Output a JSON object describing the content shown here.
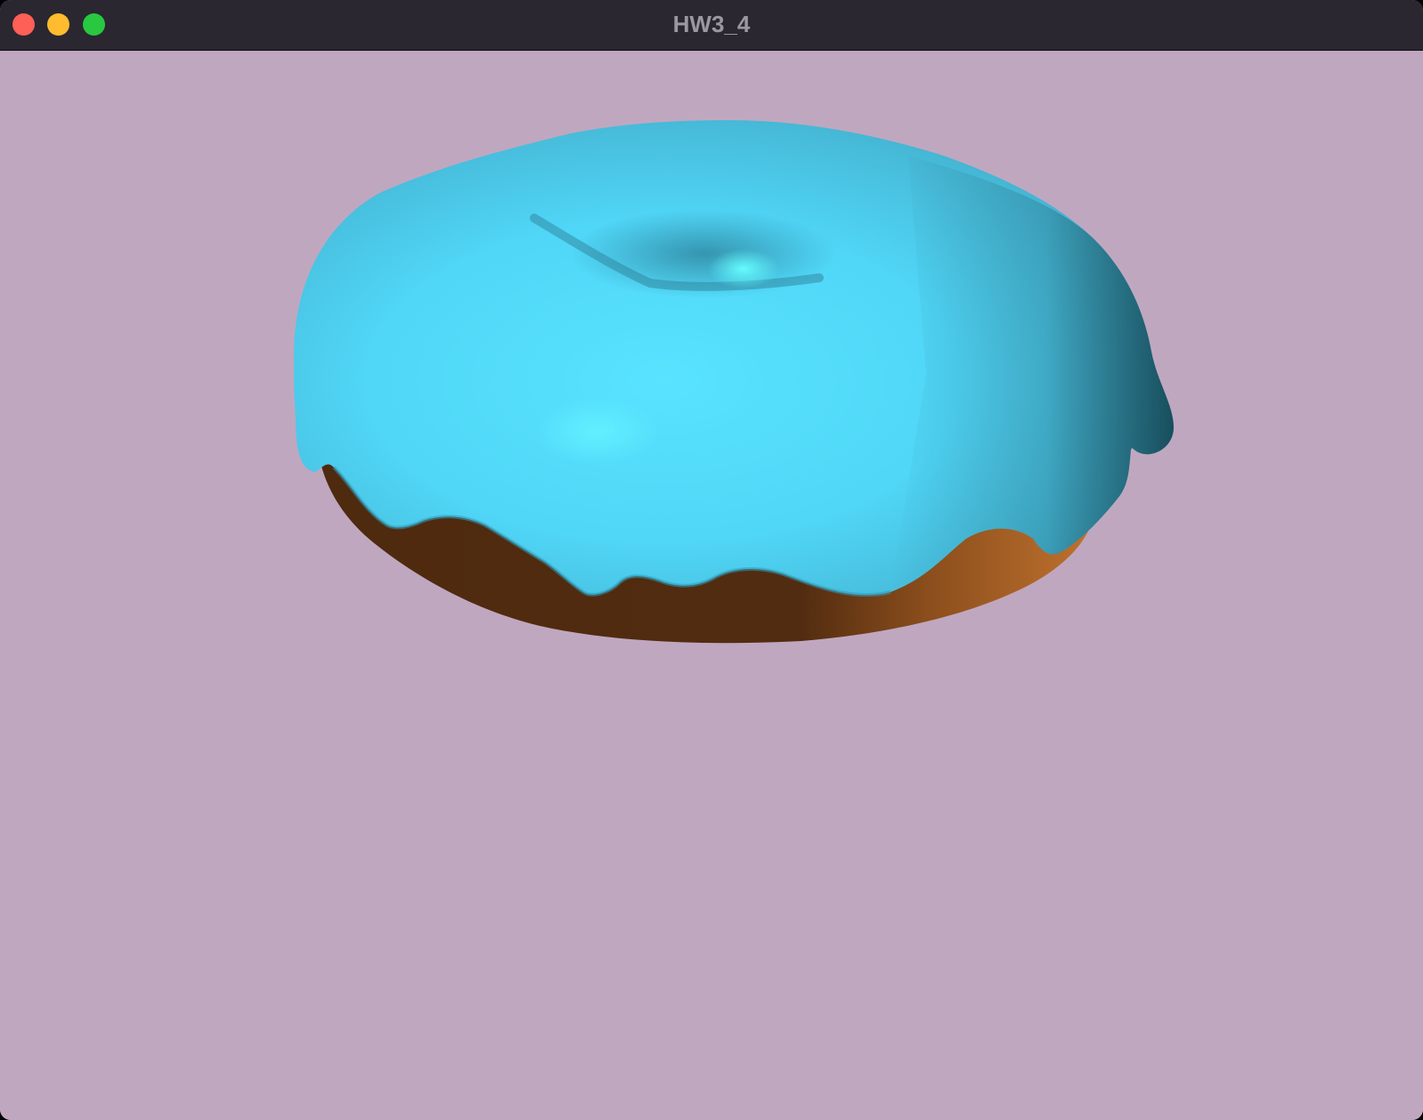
{
  "window": {
    "title": "HW3_4",
    "controls": {
      "close": "close",
      "minimize": "minimize",
      "zoom": "zoom"
    }
  },
  "scene": {
    "background_color": "#c0a7c0",
    "object": "donut",
    "icing_color": "#4fd3f2",
    "dough_color": "#522c10",
    "dough_lit_color": "#b8682a"
  }
}
